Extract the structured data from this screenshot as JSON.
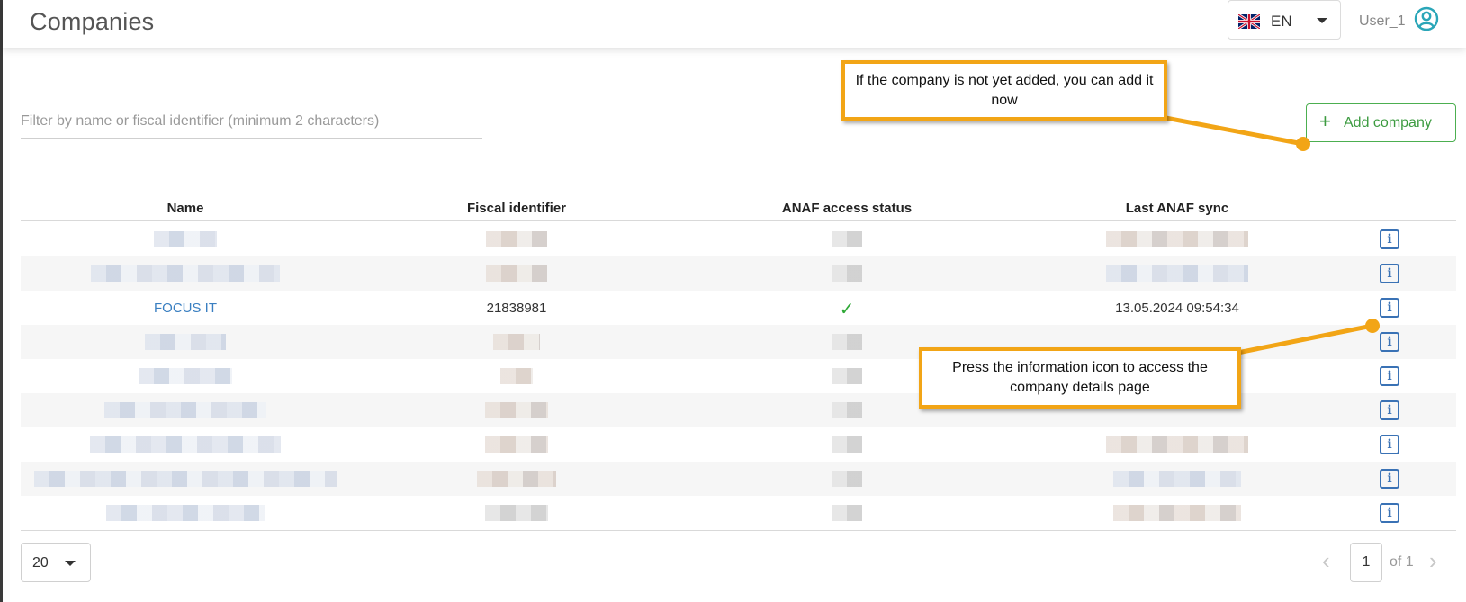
{
  "header": {
    "title": "Companies",
    "language": {
      "label": "EN",
      "flag_icon": "uk-flag-icon"
    },
    "user": {
      "name": "User_1",
      "icon": "user-circle-icon"
    }
  },
  "filter": {
    "placeholder": "Filter by name or fiscal identifier (minimum 2 characters)",
    "value": ""
  },
  "toolbar": {
    "add_company_label": "Add company",
    "add_icon": "plus-icon"
  },
  "table": {
    "columns": [
      "Name",
      "Fiscal identifier",
      "ANAF access status",
      "Last ANAF sync"
    ],
    "visible_row": {
      "name": "FOCUS IT",
      "fiscal_identifier": "21838981",
      "anaf_status_icon": "check-icon",
      "last_sync": "13.05.2024 09:54:34"
    },
    "info_icon": "info-icon"
  },
  "pagination": {
    "page_size": "20",
    "current_page": "1",
    "of_label": "of",
    "total_pages": "1"
  },
  "callouts": {
    "add": "If the company is not yet added, you can add it now",
    "info": "Press the information icon to access the company details page"
  },
  "colors": {
    "accent_green": "#4caf50",
    "link_blue": "#3a7fc1",
    "callout_orange": "#f2a516"
  }
}
